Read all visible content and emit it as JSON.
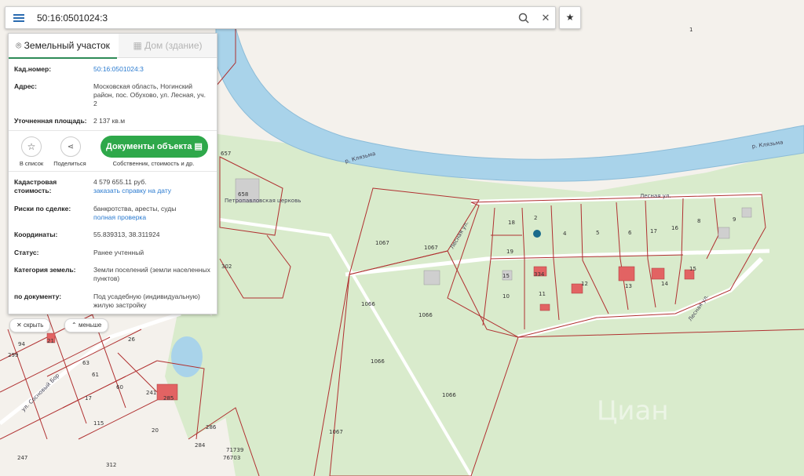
{
  "search": {
    "value": "50:16:0501024:3"
  },
  "icons": {
    "menu": "menu-icon",
    "search": "search-icon",
    "clear": "close-icon",
    "favorite": "star-icon"
  },
  "tabs": [
    {
      "label": "Земельный участок",
      "active": true
    },
    {
      "label": "Дом (здание)",
      "active": false
    }
  ],
  "details": {
    "cad_label": "Кад.номер:",
    "cad_value": "50:16:0501024:3",
    "address_label": "Адрес:",
    "address_value": "Московская область, Ногинский район, пос. Обухово, ул. Лесная, уч. 2",
    "area_label": "Уточненная площадь:",
    "area_value": "2 137 кв.м"
  },
  "actions": {
    "list_label": "В список",
    "share_label": "Поделиться",
    "docs_button": "Документы объекта",
    "docs_sub": "Собственник, стоимость и др."
  },
  "info": {
    "cost_label": "Кадастровая стоимость:",
    "cost_value": "4 579 655.11 руб.",
    "cost_link": "заказать справку на дату",
    "risks_label": "Риски по сделке:",
    "risks_value": "банкротства, аресты, суды",
    "risks_link": "полная проверка",
    "coords_label": "Координаты:",
    "coords_value": "55.839313, 38.311924",
    "status_label": "Статус:",
    "status_value": "Ранее учтенный",
    "category_label": "Категория земель:",
    "category_value": "Земли поселений (земли населенных пунктов)",
    "doc_label": "по документу:",
    "doc_value": "Под усадебную (индивидуальную) жилую застройку"
  },
  "controls": {
    "hide": "скрыть",
    "less": "меньше"
  },
  "map": {
    "river_label_1": "р. Клязьма",
    "river_label_2": "р. Клязьма",
    "street_lesnaya_1": "Лесная ул.",
    "street_lesnaya_2": "Лесная ул.",
    "street_lesnaya_3": "Лесная ул.",
    "street_sosnovy": "ул. Сосновый Бор",
    "church": "Петропавловская церковь",
    "watermark": "Циан",
    "parcel_labels": [
      "1",
      "657",
      "658",
      "302",
      "1067",
      "1067",
      "1066",
      "1066",
      "1066",
      "1066",
      "1067",
      "18",
      "2",
      "4",
      "5",
      "6",
      "17",
      "16",
      "8",
      "9",
      "19",
      "15",
      "334",
      "12",
      "13",
      "14",
      "15",
      "10",
      "11",
      "26",
      "241",
      "285",
      "115",
      "20",
      "286",
      "284",
      "71739",
      "76703",
      "312",
      "247",
      "299",
      "94",
      "21",
      "63",
      "61",
      "60",
      "17"
    ]
  },
  "colors": {
    "water": "#a9d3ea",
    "forest": "#d7ebc7",
    "parcel_line": "#b03030",
    "building": "#e26363",
    "accent": "#2ea84a"
  }
}
